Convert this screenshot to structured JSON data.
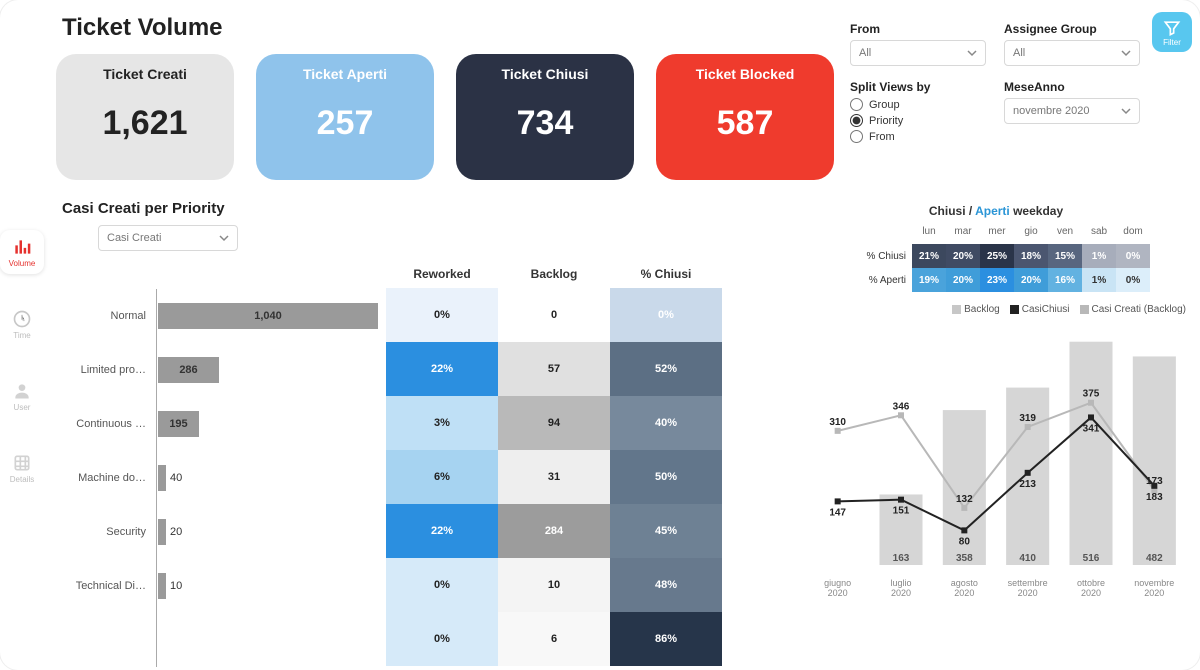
{
  "title": "Ticket Volume",
  "sidebar": [
    {
      "name": "volume",
      "label": "Volume",
      "active": true
    },
    {
      "name": "time",
      "label": "Time",
      "active": false
    },
    {
      "name": "user",
      "label": "User",
      "active": false
    },
    {
      "name": "details",
      "label": "Details",
      "active": false
    }
  ],
  "kpis": {
    "creati": {
      "label": "Ticket Creati",
      "value": "1,621"
    },
    "aperti": {
      "label": "Ticket Aperti",
      "value": "257"
    },
    "chiusi": {
      "label": "Ticket Chiusi",
      "value": "734"
    },
    "blocked": {
      "label": "Ticket Blocked",
      "value": "587"
    }
  },
  "filters": {
    "from": {
      "label": "From",
      "value": "All"
    },
    "assignee": {
      "label": "Assignee Group",
      "value": "All"
    },
    "split": {
      "label": "Split Views by",
      "options": [
        "Group",
        "Priority",
        "From"
      ],
      "selected": "Priority"
    },
    "meseAnno": {
      "label": "MeseAnno",
      "value": "novembre 2020"
    },
    "filterBtnLabel": "Filter"
  },
  "priority": {
    "title": "Casi Creati per Priority",
    "selector": "Casi Creati",
    "headers": [
      "Reworked",
      "Backlog",
      "% Chiusi"
    ],
    "maxBar": 1040,
    "rows": [
      {
        "label": "Normal",
        "bar": 1040,
        "reworked": {
          "v": "0%",
          "bg": "#eaf2fb"
        },
        "backlog": {
          "v": "0",
          "bg": "#ffffff"
        },
        "pclose": {
          "v": "0%",
          "bg": "#c9d9ea",
          "fg": "#fff"
        }
      },
      {
        "label": "Limited pro…",
        "bar": 286,
        "reworked": {
          "v": "22%",
          "bg": "#2b8fe0",
          "fg": "#fff"
        },
        "backlog": {
          "v": "57",
          "bg": "#e0e0e0"
        },
        "pclose": {
          "v": "52%",
          "bg": "#5c6f84",
          "fg": "#fff"
        }
      },
      {
        "label": "Continuous …",
        "bar": 195,
        "reworked": {
          "v": "3%",
          "bg": "#bfe0f6"
        },
        "backlog": {
          "v": "94",
          "bg": "#b9b9b9"
        },
        "pclose": {
          "v": "40%",
          "bg": "#77899c",
          "fg": "#fff"
        }
      },
      {
        "label": "Machine do…",
        "bar": 40,
        "reworked": {
          "v": "6%",
          "bg": "#a6d3f1"
        },
        "backlog": {
          "v": "31",
          "bg": "#eeeeee"
        },
        "pclose": {
          "v": "50%",
          "bg": "#62768b",
          "fg": "#fff"
        }
      },
      {
        "label": "Security",
        "bar": 20,
        "reworked": {
          "v": "22%",
          "bg": "#2b8fe0",
          "fg": "#fff"
        },
        "backlog": {
          "v": "284",
          "bg": "#9c9c9c",
          "fg": "#fff"
        },
        "pclose": {
          "v": "45%",
          "bg": "#6e8194",
          "fg": "#fff"
        }
      },
      {
        "label": "Technical Di…",
        "bar": 10,
        "reworked": {
          "v": "0%",
          "bg": "#d6eaf9"
        },
        "backlog": {
          "v": "10",
          "bg": "#f4f4f4"
        },
        "pclose": {
          "v": "48%",
          "bg": "#67798d",
          "fg": "#fff"
        }
      },
      {
        "label": "",
        "bar": 0,
        "reworked": {
          "v": "0%",
          "bg": "#d6eaf9"
        },
        "backlog": {
          "v": "6",
          "bg": "#f8f8f8"
        },
        "pclose": {
          "v": "86%",
          "bg": "#26354a",
          "fg": "#fff"
        }
      }
    ]
  },
  "weekday": {
    "title_left": "Chiusi",
    "title_sep": " / ",
    "title_right": "Aperti",
    "title_tail": " weekday",
    "days": [
      "lun",
      "mar",
      "mer",
      "gio",
      "ven",
      "sab",
      "dom"
    ],
    "rows": [
      {
        "name": "% Chiusi",
        "cells": [
          {
            "v": "21%",
            "bg": "#3c485e"
          },
          {
            "v": "20%",
            "bg": "#404b63"
          },
          {
            "v": "25%",
            "bg": "#2a3449"
          },
          {
            "v": "18%",
            "bg": "#4b5670"
          },
          {
            "v": "15%",
            "bg": "#58667f"
          },
          {
            "v": "1%",
            "bg": "#a7adbb"
          },
          {
            "v": "0%",
            "bg": "#b0b5c1"
          }
        ]
      },
      {
        "name": "% Aperti",
        "cells": [
          {
            "v": "19%",
            "bg": "#4aa3db"
          },
          {
            "v": "20%",
            "bg": "#3f9dd9"
          },
          {
            "v": "23%",
            "bg": "#2b8fe0"
          },
          {
            "v": "20%",
            "bg": "#3f9dd9"
          },
          {
            "v": "16%",
            "bg": "#62b2e1"
          },
          {
            "v": "1%",
            "bg": "#c9e4f5"
          },
          {
            "v": "0%",
            "bg": "#dceefa"
          }
        ]
      }
    ]
  },
  "trend_legend": {
    "a": "Backlog",
    "b": "CasiChiusi",
    "c": "Casi Creati (Backlog)"
  },
  "chart_data": [
    {
      "type": "bar",
      "title": "Casi Creati per Priority",
      "categories": [
        "Normal",
        "Limited production",
        "Continuous",
        "Machine down",
        "Security",
        "Technical Disaster"
      ],
      "series": [
        {
          "name": "Casi Creati",
          "values": [
            1040,
            286,
            195,
            40,
            20,
            10
          ]
        },
        {
          "name": "Reworked %",
          "values": [
            0,
            22,
            3,
            6,
            22,
            0,
            0
          ]
        },
        {
          "name": "Backlog",
          "values": [
            0,
            57,
            94,
            31,
            284,
            10,
            6
          ]
        },
        {
          "name": "% Chiusi",
          "values": [
            0,
            52,
            40,
            50,
            45,
            48,
            86
          ]
        }
      ]
    },
    {
      "type": "heatmap",
      "title": "Chiusi / Aperti weekday",
      "categories": [
        "lun",
        "mar",
        "mer",
        "gio",
        "ven",
        "sab",
        "dom"
      ],
      "series": [
        {
          "name": "% Chiusi",
          "values": [
            21,
            20,
            25,
            18,
            15,
            1,
            0
          ]
        },
        {
          "name": "% Aperti",
          "values": [
            19,
            20,
            23,
            20,
            16,
            1,
            0
          ]
        }
      ]
    },
    {
      "type": "line",
      "title": "Backlog / CasiChiusi / Casi Creati (Backlog)",
      "x": [
        "giugno 2020",
        "luglio 2020",
        "agosto 2020",
        "settembre 2020",
        "ottobre 2020",
        "novembre 2020"
      ],
      "ylim": [
        0,
        550
      ],
      "series": [
        {
          "name": "Backlog",
          "kind": "line",
          "values": [
            310,
            346,
            132,
            319,
            375,
            173
          ]
        },
        {
          "name": "CasiChiusi",
          "kind": "line",
          "values": [
            147,
            151,
            80,
            213,
            341,
            183
          ]
        },
        {
          "name": "Casi Creati (Backlog)",
          "kind": "bar",
          "values": [
            null,
            163,
            358,
            410,
            516,
            482
          ]
        }
      ]
    }
  ]
}
